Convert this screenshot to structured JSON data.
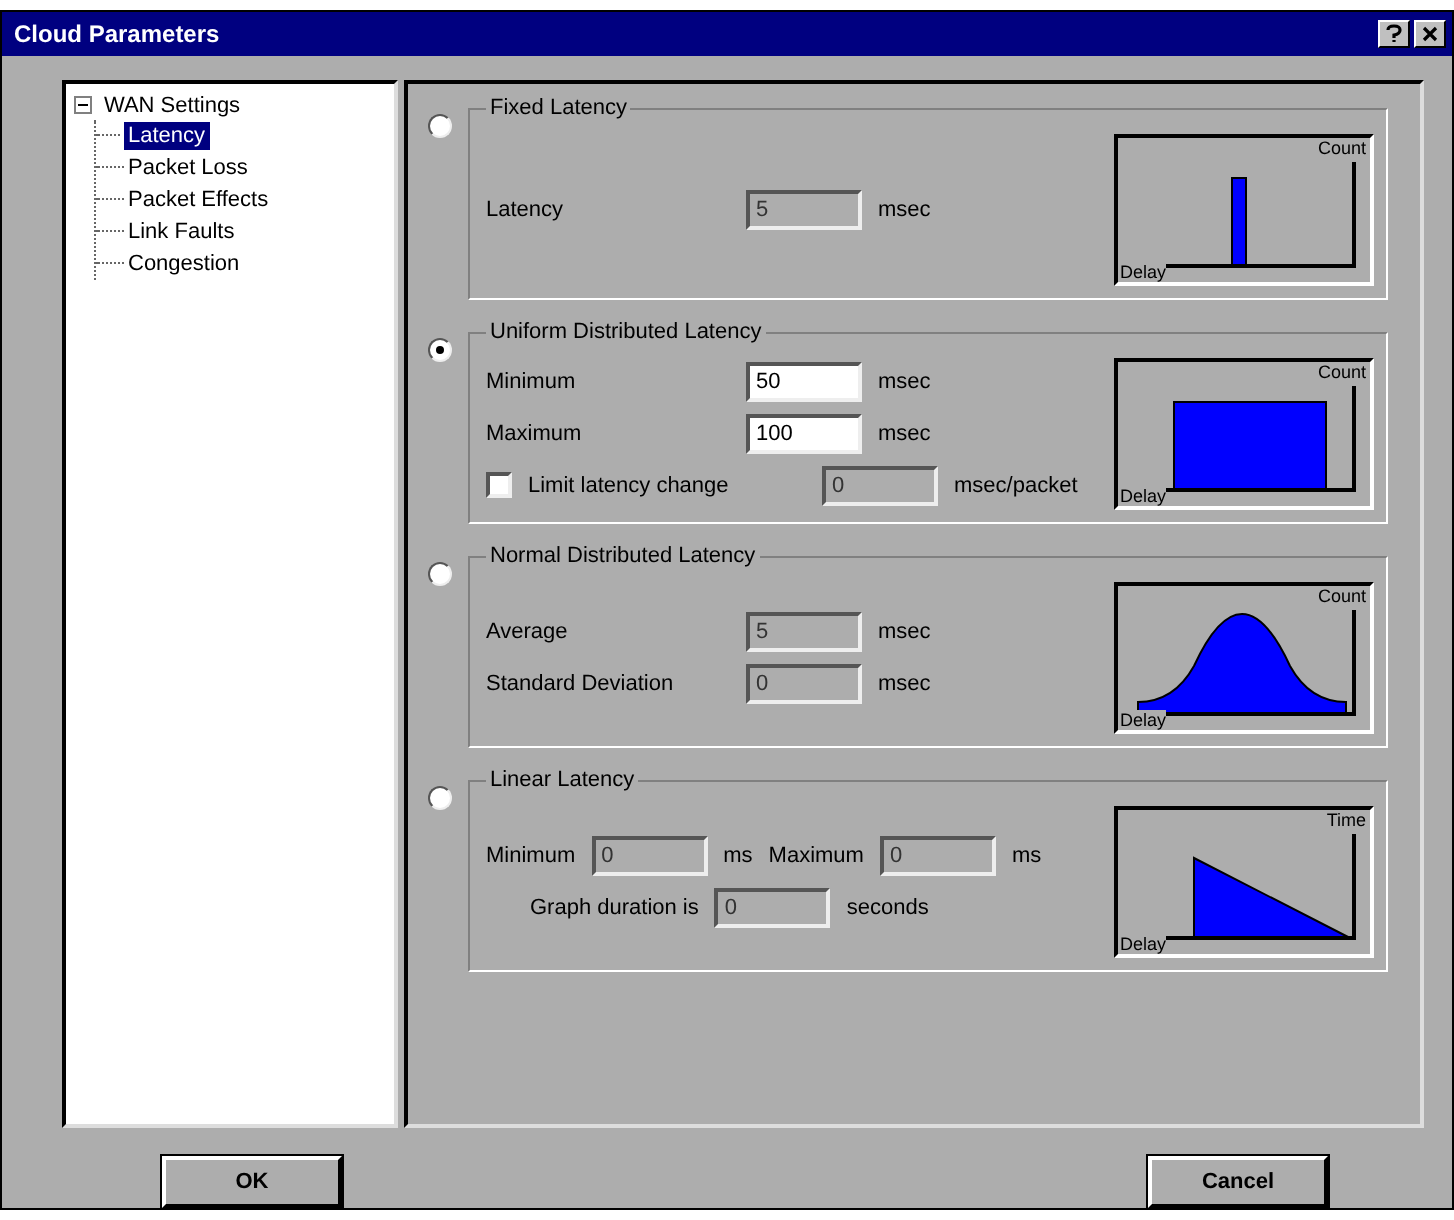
{
  "window": {
    "title": "Cloud Parameters"
  },
  "tree": {
    "label": "WAN Settings",
    "expanded": true,
    "children": [
      {
        "label": "Latency",
        "selected": true
      },
      {
        "label": "Packet Loss",
        "selected": false
      },
      {
        "label": "Packet Effects",
        "selected": false
      },
      {
        "label": "Link Faults",
        "selected": false
      },
      {
        "label": "Congestion",
        "selected": false
      }
    ]
  },
  "options": [
    {
      "kind": "fixed",
      "title": "Fixed Latency",
      "selected": false,
      "graph": {
        "y_label": "Count",
        "x_label": "Delay"
      },
      "lines": [
        {
          "items": [
            {
              "kind": "label",
              "text": "Latency"
            },
            {
              "kind": "field",
              "value": "5",
              "disabled": true
            },
            {
              "kind": "unit",
              "text": "msec"
            }
          ]
        }
      ]
    },
    {
      "kind": "uniform",
      "title": "Uniform Distributed Latency",
      "selected": true,
      "graph": {
        "y_label": "Count",
        "x_label": "Delay"
      },
      "lines": [
        {
          "items": [
            {
              "kind": "label",
              "text": "Minimum"
            },
            {
              "kind": "field",
              "value": "50",
              "disabled": false
            },
            {
              "kind": "unit",
              "text": "msec"
            }
          ]
        },
        {
          "items": [
            {
              "kind": "label",
              "text": "Maximum"
            },
            {
              "kind": "field",
              "value": "100",
              "disabled": false
            },
            {
              "kind": "unit",
              "text": "msec"
            }
          ]
        },
        {
          "items": [
            {
              "kind": "checkbox",
              "text": "Limit latency change",
              "checked": false
            },
            {
              "kind": "field",
              "value": "0",
              "disabled": true
            },
            {
              "kind": "unit",
              "text": "msec/packet"
            }
          ]
        }
      ]
    },
    {
      "kind": "normal",
      "title": "Normal Distributed Latency",
      "selected": false,
      "graph": {
        "y_label": "Count",
        "x_label": "Delay"
      },
      "lines": [
        {
          "items": [
            {
              "kind": "label",
              "text": "Average"
            },
            {
              "kind": "field",
              "value": "5",
              "disabled": true
            },
            {
              "kind": "unit",
              "text": "msec"
            }
          ]
        },
        {
          "items": [
            {
              "kind": "label",
              "text": "Standard Deviation"
            },
            {
              "kind": "field",
              "value": "0",
              "disabled": true
            },
            {
              "kind": "unit",
              "text": "msec"
            }
          ]
        }
      ]
    },
    {
      "kind": "linear",
      "title": "Linear Latency",
      "selected": false,
      "graph": {
        "y_label": "Time",
        "x_label": "Delay"
      },
      "lines": [
        {
          "items": [
            {
              "kind": "label",
              "text": "Minimum"
            },
            {
              "kind": "field",
              "value": "0",
              "disabled": true
            },
            {
              "kind": "unit",
              "text": "ms"
            },
            {
              "kind": "label",
              "text": "Maximum"
            },
            {
              "kind": "field",
              "value": "0",
              "disabled": true
            },
            {
              "kind": "unit",
              "text": "ms"
            }
          ]
        },
        {
          "items": [
            {
              "kind": "label",
              "text": "Graph duration is"
            },
            {
              "kind": "field",
              "value": "0",
              "disabled": true
            },
            {
              "kind": "unit",
              "text": "seconds"
            }
          ]
        }
      ]
    }
  ],
  "buttons": [
    {
      "label": "OK"
    },
    {
      "label": "Cancel"
    }
  ]
}
